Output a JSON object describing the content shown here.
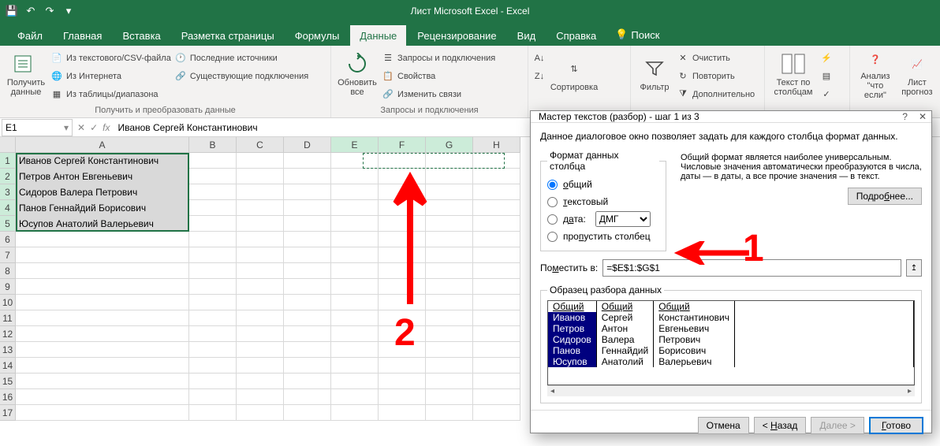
{
  "title": "Лист Microsoft Excel  -  Excel",
  "tabs": {
    "file": "Файл",
    "home": "Главная",
    "insert": "Вставка",
    "page_layout": "Разметка страницы",
    "formulas": "Формулы",
    "data": "Данные",
    "review": "Рецензирование",
    "view": "Вид",
    "help": "Справка",
    "tell_me": "Поиск"
  },
  "ribbon": {
    "get_data_btn": "Получить данные",
    "from_text_csv": "Из текстового/CSV-файла",
    "from_web": "Из Интернета",
    "from_table": "Из таблицы/диапазона",
    "recent_sources": "Последние источники",
    "existing_conn": "Существующие подключения",
    "get_transform_label": "Получить и преобразовать данные",
    "refresh_all": "Обновить все",
    "queries_conn": "Запросы и подключения",
    "properties": "Свойства",
    "edit_links": "Изменить связи",
    "queries_label": "Запросы и подключения",
    "sort": "Сортировка",
    "filter": "Фильтр",
    "clear": "Очистить",
    "reapply": "Повторить",
    "advanced": "Дополнительно",
    "text_to_columns": "Текст по столбцам",
    "what_if": "Анализ \"что если\"",
    "forecast_sheet": "Лист прогноз"
  },
  "name_box": "E1",
  "formula": "Иванов Сергей Константинович",
  "columns": [
    "A",
    "B",
    "C",
    "D",
    "E",
    "F",
    "G",
    "H"
  ],
  "rows": [
    "Иванов Сергей Константинович",
    "Петров Антон Евгеньевич",
    "Сидоров Валера Петрович",
    "Панов Геннайдий Борисович",
    "Юсупов Анатолий Валерьевич"
  ],
  "row_count": 17,
  "dialog": {
    "title": "Мастер текстов (разбор) - шаг 1 из 3",
    "help": "?",
    "close": "✕",
    "intro": "Данное диалоговое окно позволяет задать для каждого столбца формат данных.",
    "format_legend": "Формат данных столбца",
    "opt_general": "общий",
    "opt_text": "текстовый",
    "opt_date": "дата:",
    "date_fmt": "ДМГ",
    "opt_skip": "пропустить столбец",
    "info": "Общий формат является наиболее универсальным. Числовые значения автоматически преобразуются в числа, даты — в даты, а все прочие значения — в текст.",
    "btn_more": "Подробнее...",
    "place_label": "Поместить в:",
    "place_value": "=$E$1:$G$1",
    "preview_legend": "Образец разбора данных",
    "preview_hdr": "Общий",
    "preview_rows": [
      [
        "Иванов",
        "Сергей",
        "Константинович"
      ],
      [
        "Петров",
        "Антон",
        "Евгеньевич"
      ],
      [
        "Сидоров",
        "Валера",
        "Петрович"
      ],
      [
        "Панов",
        "Геннайдий",
        "Борисович"
      ],
      [
        "Юсупов",
        "Анатолий",
        "Валерьевич"
      ]
    ],
    "btn_cancel": "Отмена",
    "btn_back": "< Назад",
    "btn_next": "Далее >",
    "btn_finish": "Готово"
  },
  "annotations": {
    "one": "1",
    "two": "2"
  }
}
